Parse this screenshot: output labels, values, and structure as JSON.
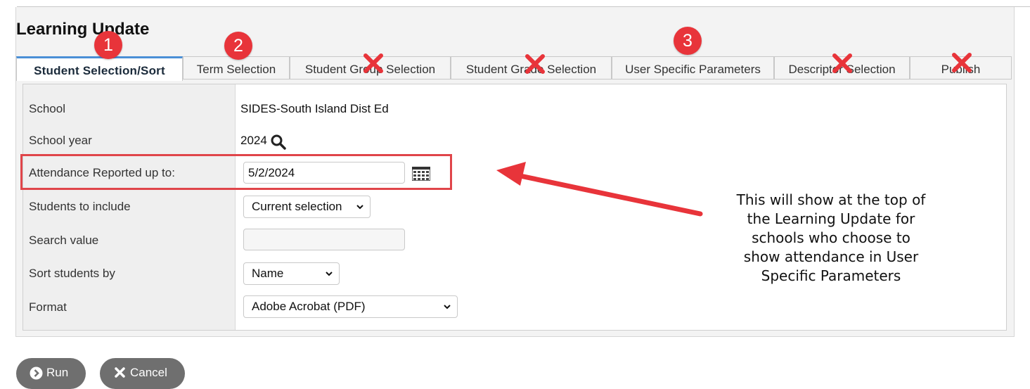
{
  "page": {
    "title": "Learning Update"
  },
  "tabs": [
    {
      "label": "Student Selection/Sort"
    },
    {
      "label": "Term Selection"
    },
    {
      "label": "Student Group Selection"
    },
    {
      "label": "Student Grade Selection"
    },
    {
      "label": "User Specific Parameters"
    },
    {
      "label": "Descriptor Selection"
    },
    {
      "label": "Publish"
    }
  ],
  "badges": [
    "1",
    "2",
    "3"
  ],
  "fields": {
    "school": {
      "label": "School",
      "value": "SIDES-South Island Dist Ed"
    },
    "school_year": {
      "label": "School year",
      "value": "2024"
    },
    "attendance": {
      "label": "Attendance Reported up to:",
      "value": "5/2/2024"
    },
    "students_include": {
      "label": "Students to include",
      "value": "Current selection"
    },
    "search_value": {
      "label": "Search value",
      "value": ""
    },
    "sort_by": {
      "label": "Sort students by",
      "value": "Name"
    },
    "format": {
      "label": "Format",
      "value": "Adobe Acrobat (PDF)"
    }
  },
  "annotation": {
    "lines": [
      "This will show at the top of",
      "the Learning Update for",
      "schools who choose to",
      "show attendance in User",
      "Specific Parameters"
    ]
  },
  "buttons": {
    "run": "Run",
    "cancel": "Cancel"
  },
  "icons": {
    "school_year_lookup": "magnifier-icon",
    "date_picker": "calendar-icon",
    "run": "chevron-right-circle-icon",
    "cancel": "close-icon",
    "excluded_tab": "red-x-icon",
    "annotation_arrow": "red-arrow-icon"
  },
  "colors": {
    "accent": "#4a8fd6",
    "annotation_red": "#e8343a",
    "button_gray": "#6f6f6f"
  }
}
